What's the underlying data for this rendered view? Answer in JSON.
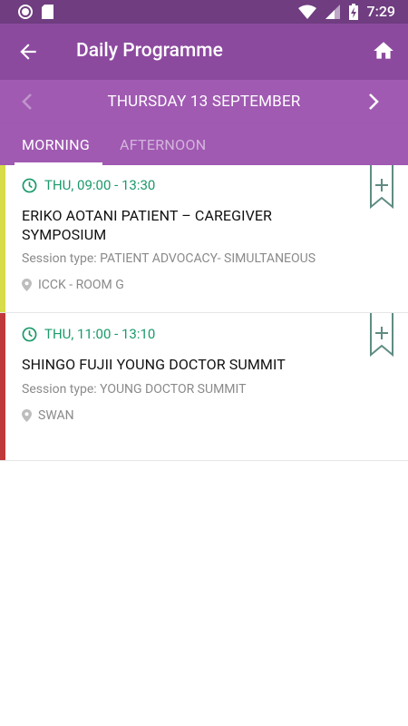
{
  "status_bar": {
    "time": "7:29",
    "icons": [
      "circle-notification-icon",
      "sd-card-icon",
      "wifi-icon",
      "signal-icon",
      "battery-charging-icon"
    ]
  },
  "app_bar": {
    "title": "Daily Programme",
    "back_icon": "arrow-left-icon",
    "home_icon": "home-icon"
  },
  "date_nav": {
    "date": "THURSDAY 13 SEPTEMBER",
    "prev_icon": "chevron-left-icon",
    "next_icon": "chevron-right-icon"
  },
  "tabs": [
    {
      "label": "MORNING",
      "selected": true
    },
    {
      "label": "AFTERNOON",
      "selected": false
    }
  ],
  "sessions": [
    {
      "time": "THU, 09:00 - 13:30",
      "title": "ERIKO AOTANI PATIENT – CAREGIVER SYMPOSIUM",
      "session_type": "Session type: PATIENT ADVOCACY- SIMULTANEOUS",
      "location": "ICCK - ROOM G",
      "stripe_color": "#d8db4a"
    },
    {
      "time": "THU, 11:00 - 13:10",
      "title": "SHINGO FUJII YOUNG DOCTOR SUMMIT",
      "session_type": "Session type: YOUNG DOCTOR SUMMIT",
      "location": "SWAN",
      "stripe_color": "#c0393a"
    }
  ],
  "colors": {
    "status_bar": "#6f3d80",
    "app_bar": "#8c4a9f",
    "date_bar": "#a05ab2",
    "time_text": "#1a9a6a",
    "bookmark": "#5f8c82"
  }
}
